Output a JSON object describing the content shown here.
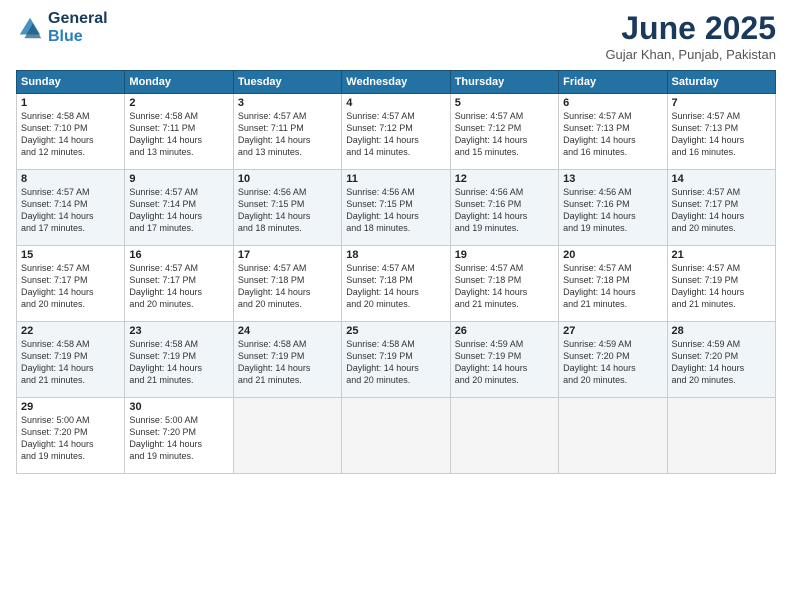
{
  "logo": {
    "line1": "General",
    "line2": "Blue"
  },
  "title": "June 2025",
  "subtitle": "Gujar Khan, Punjab, Pakistan",
  "header_days": [
    "Sunday",
    "Monday",
    "Tuesday",
    "Wednesday",
    "Thursday",
    "Friday",
    "Saturday"
  ],
  "weeks": [
    [
      {
        "num": "1",
        "sunrise": "4:58 AM",
        "sunset": "7:10 PM",
        "daylight": "14 hours and 12 minutes."
      },
      {
        "num": "2",
        "sunrise": "4:58 AM",
        "sunset": "7:11 PM",
        "daylight": "14 hours and 13 minutes."
      },
      {
        "num": "3",
        "sunrise": "4:57 AM",
        "sunset": "7:11 PM",
        "daylight": "14 hours and 13 minutes."
      },
      {
        "num": "4",
        "sunrise": "4:57 AM",
        "sunset": "7:12 PM",
        "daylight": "14 hours and 14 minutes."
      },
      {
        "num": "5",
        "sunrise": "4:57 AM",
        "sunset": "7:12 PM",
        "daylight": "14 hours and 15 minutes."
      },
      {
        "num": "6",
        "sunrise": "4:57 AM",
        "sunset": "7:13 PM",
        "daylight": "14 hours and 16 minutes."
      },
      {
        "num": "7",
        "sunrise": "4:57 AM",
        "sunset": "7:13 PM",
        "daylight": "14 hours and 16 minutes."
      }
    ],
    [
      {
        "num": "8",
        "sunrise": "4:57 AM",
        "sunset": "7:14 PM",
        "daylight": "14 hours and 17 minutes."
      },
      {
        "num": "9",
        "sunrise": "4:57 AM",
        "sunset": "7:14 PM",
        "daylight": "14 hours and 17 minutes."
      },
      {
        "num": "10",
        "sunrise": "4:56 AM",
        "sunset": "7:15 PM",
        "daylight": "14 hours and 18 minutes."
      },
      {
        "num": "11",
        "sunrise": "4:56 AM",
        "sunset": "7:15 PM",
        "daylight": "14 hours and 18 minutes."
      },
      {
        "num": "12",
        "sunrise": "4:56 AM",
        "sunset": "7:16 PM",
        "daylight": "14 hours and 19 minutes."
      },
      {
        "num": "13",
        "sunrise": "4:56 AM",
        "sunset": "7:16 PM",
        "daylight": "14 hours and 19 minutes."
      },
      {
        "num": "14",
        "sunrise": "4:57 AM",
        "sunset": "7:17 PM",
        "daylight": "14 hours and 20 minutes."
      }
    ],
    [
      {
        "num": "15",
        "sunrise": "4:57 AM",
        "sunset": "7:17 PM",
        "daylight": "14 hours and 20 minutes."
      },
      {
        "num": "16",
        "sunrise": "4:57 AM",
        "sunset": "7:17 PM",
        "daylight": "14 hours and 20 minutes."
      },
      {
        "num": "17",
        "sunrise": "4:57 AM",
        "sunset": "7:18 PM",
        "daylight": "14 hours and 20 minutes."
      },
      {
        "num": "18",
        "sunrise": "4:57 AM",
        "sunset": "7:18 PM",
        "daylight": "14 hours and 20 minutes."
      },
      {
        "num": "19",
        "sunrise": "4:57 AM",
        "sunset": "7:18 PM",
        "daylight": "14 hours and 21 minutes."
      },
      {
        "num": "20",
        "sunrise": "4:57 AM",
        "sunset": "7:18 PM",
        "daylight": "14 hours and 21 minutes."
      },
      {
        "num": "21",
        "sunrise": "4:57 AM",
        "sunset": "7:19 PM",
        "daylight": "14 hours and 21 minutes."
      }
    ],
    [
      {
        "num": "22",
        "sunrise": "4:58 AM",
        "sunset": "7:19 PM",
        "daylight": "14 hours and 21 minutes."
      },
      {
        "num": "23",
        "sunrise": "4:58 AM",
        "sunset": "7:19 PM",
        "daylight": "14 hours and 21 minutes."
      },
      {
        "num": "24",
        "sunrise": "4:58 AM",
        "sunset": "7:19 PM",
        "daylight": "14 hours and 21 minutes."
      },
      {
        "num": "25",
        "sunrise": "4:58 AM",
        "sunset": "7:19 PM",
        "daylight": "14 hours and 20 minutes."
      },
      {
        "num": "26",
        "sunrise": "4:59 AM",
        "sunset": "7:19 PM",
        "daylight": "14 hours and 20 minutes."
      },
      {
        "num": "27",
        "sunrise": "4:59 AM",
        "sunset": "7:20 PM",
        "daylight": "14 hours and 20 minutes."
      },
      {
        "num": "28",
        "sunrise": "4:59 AM",
        "sunset": "7:20 PM",
        "daylight": "14 hours and 20 minutes."
      }
    ],
    [
      {
        "num": "29",
        "sunrise": "5:00 AM",
        "sunset": "7:20 PM",
        "daylight": "14 hours and 19 minutes."
      },
      {
        "num": "30",
        "sunrise": "5:00 AM",
        "sunset": "7:20 PM",
        "daylight": "14 hours and 19 minutes."
      },
      null,
      null,
      null,
      null,
      null
    ]
  ]
}
